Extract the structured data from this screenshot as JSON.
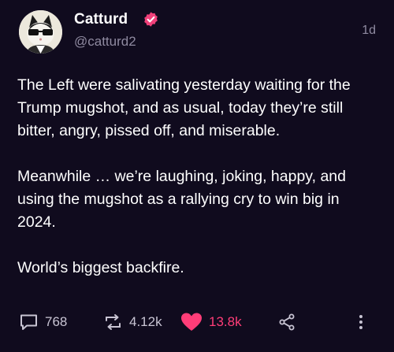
{
  "author": {
    "display_name": "Catturd",
    "handle": "@catturd2",
    "verified_badge": "verified-badge-icon",
    "badge_color": "#f0417a"
  },
  "timestamp": "1d",
  "post": {
    "paragraphs": [
      "The Left were salivating yesterday waiting for the Trump mugshot, and as usual, today they’re still bitter, angry, pissed off, and miserable.",
      "Meanwhile … we’re laughing, joking, happy, and using the mugshot as a rallying cry to win big in 2024.",
      "World’s biggest backfire."
    ]
  },
  "actions": {
    "replies": {
      "icon": "reply-icon",
      "count": "768"
    },
    "reposts": {
      "icon": "repost-icon",
      "count": "4.12k"
    },
    "likes": {
      "icon": "heart-icon",
      "count": "13.8k",
      "color": "#ff3d78",
      "liked": true
    },
    "share": {
      "icon": "share-icon"
    },
    "more": {
      "icon": "more-icon"
    }
  },
  "colors": {
    "background": "#100b1e",
    "text": "#ffffff",
    "muted": "#8f8aa0",
    "accent": "#ff3d78"
  }
}
